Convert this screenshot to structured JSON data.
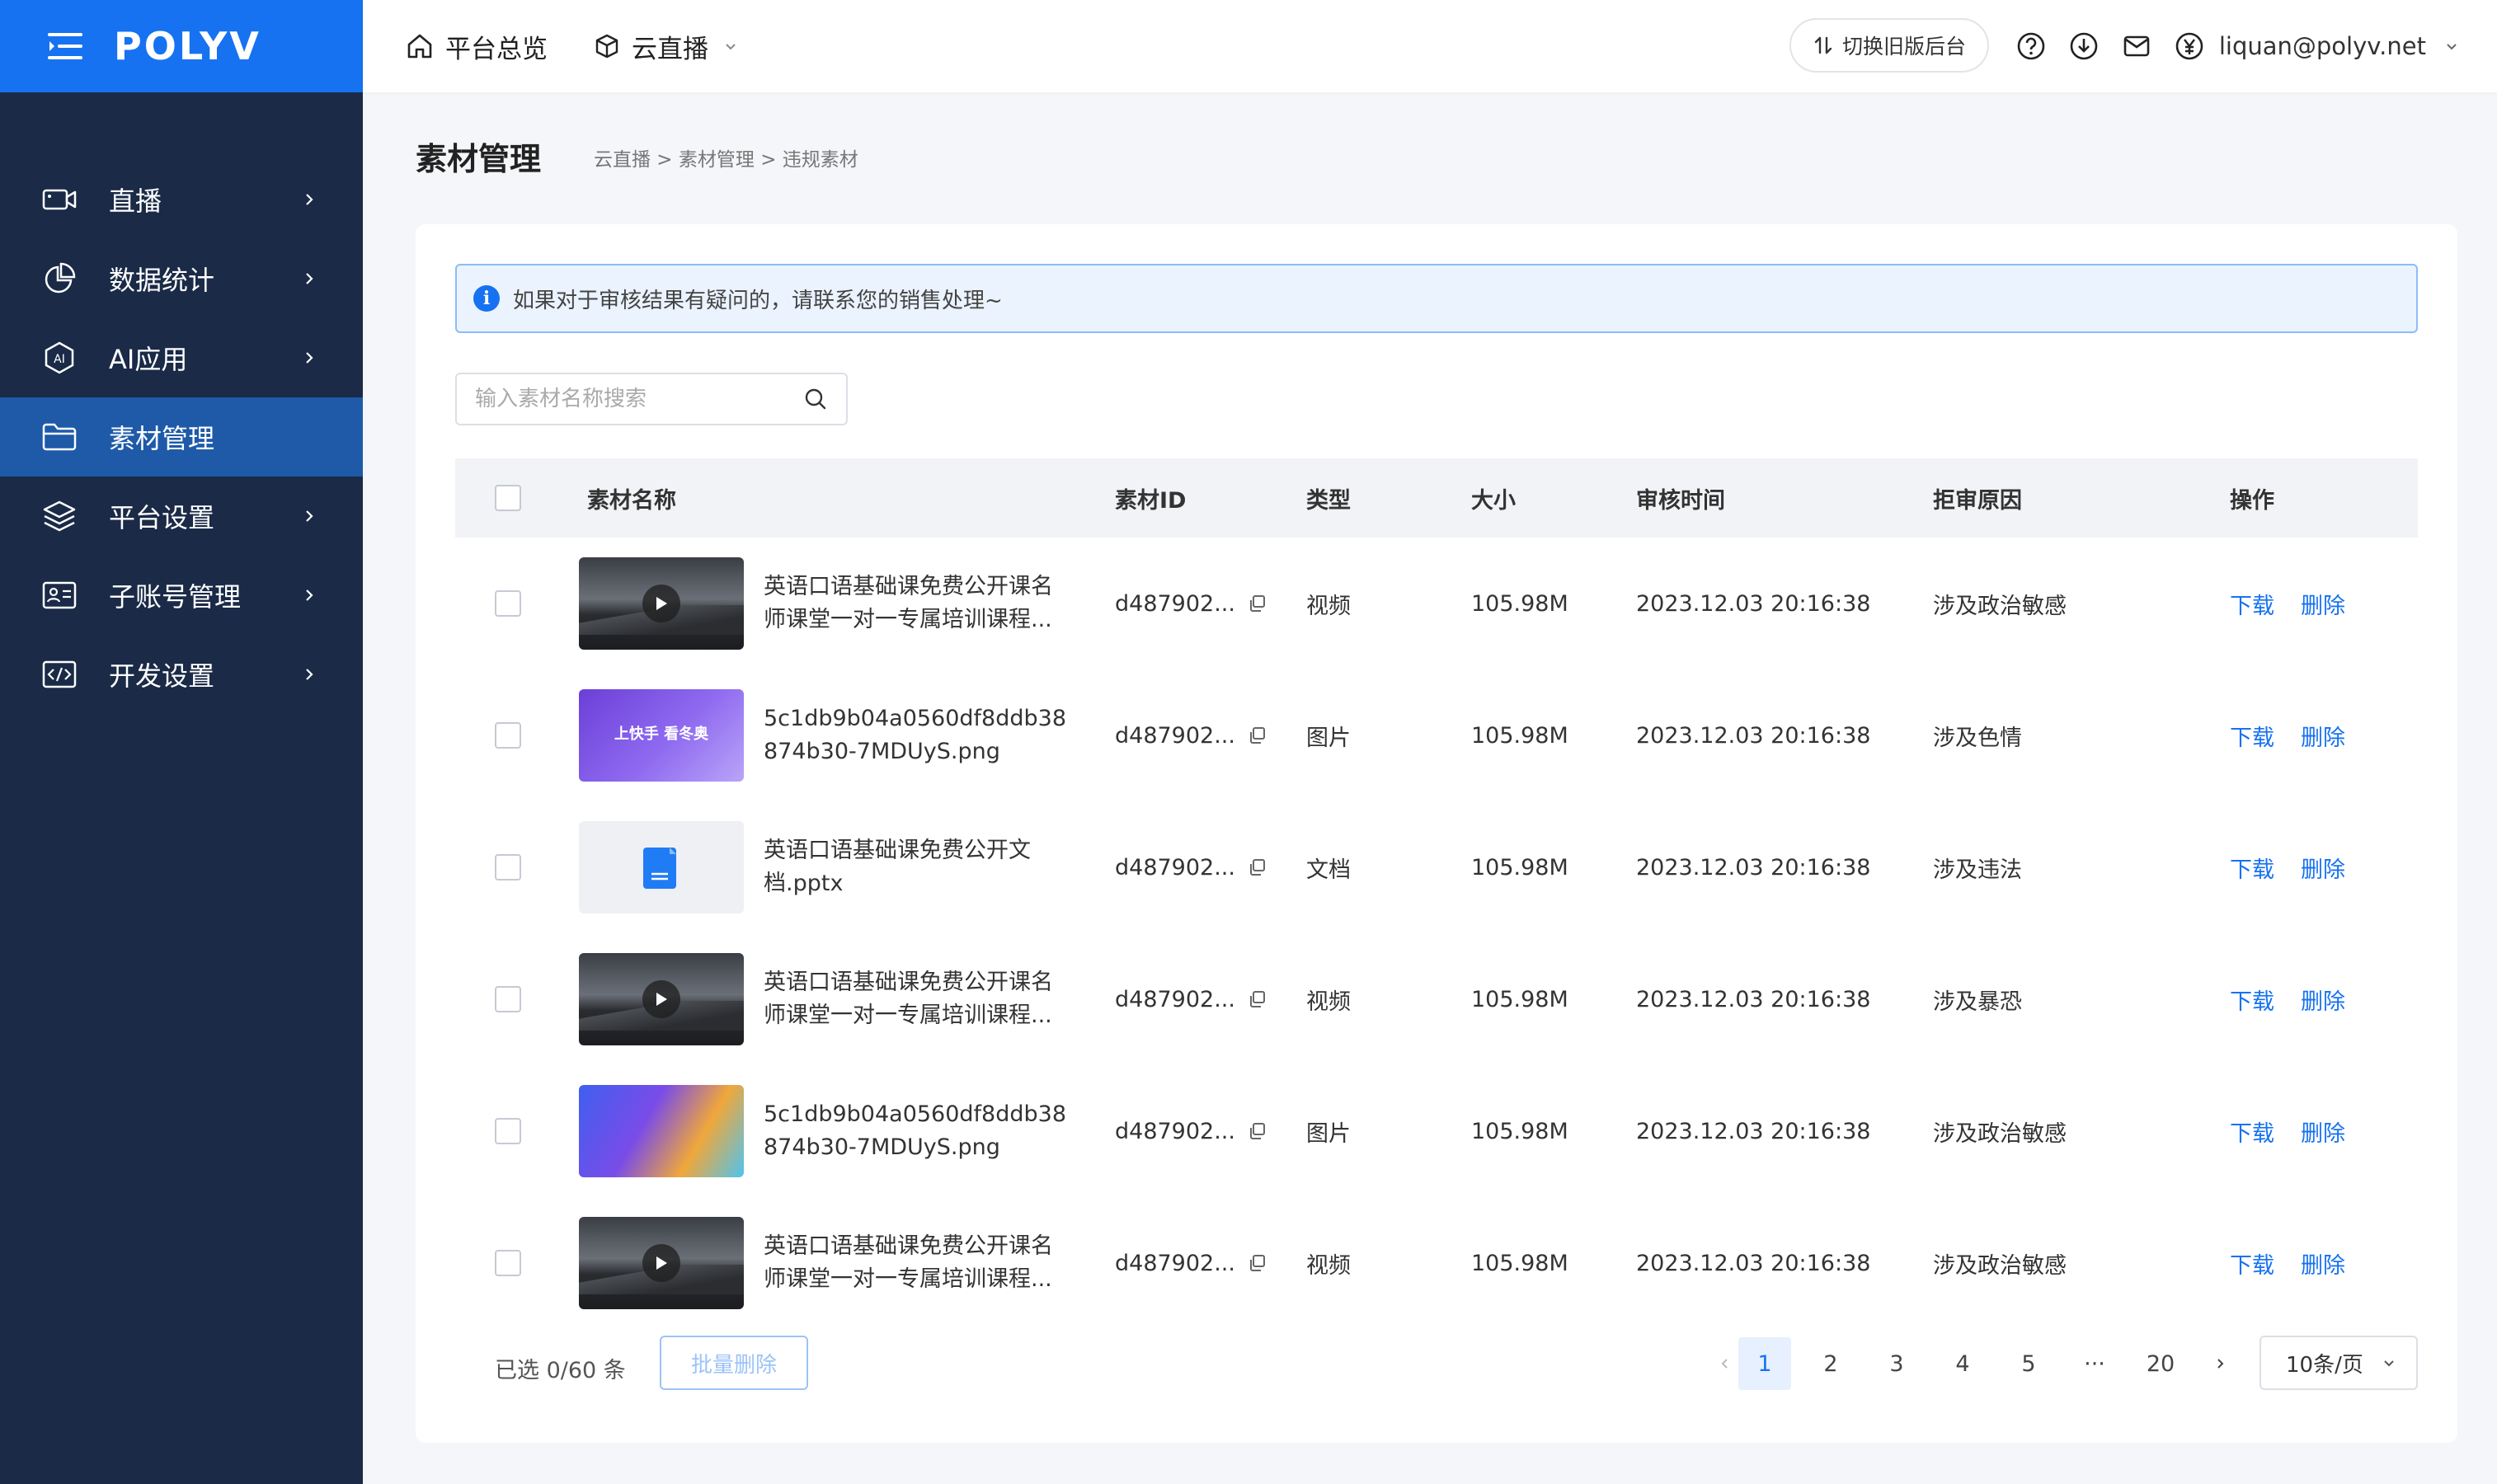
{
  "brand": {
    "logo": "POLYV",
    "primary": "#1672f1",
    "sidebar_bg": "#1a2a47",
    "active_bg": "#1e5aa8"
  },
  "sidebar": {
    "items": [
      {
        "label": "直播",
        "icon": "video-camera-icon",
        "active": false
      },
      {
        "label": "数据统计",
        "icon": "pie-chart-icon",
        "active": false
      },
      {
        "label": "AI应用",
        "icon": "ai-badge-icon",
        "active": false
      },
      {
        "label": "素材管理",
        "icon": "folder-icon",
        "active": true
      },
      {
        "label": "平台设置",
        "icon": "layers-icon",
        "active": false
      },
      {
        "label": "子账号管理",
        "icon": "id-card-icon",
        "active": false
      },
      {
        "label": "开发设置",
        "icon": "code-icon",
        "active": false
      }
    ]
  },
  "topbar": {
    "tabs": [
      {
        "label": "平台总览",
        "icon": "home-icon"
      },
      {
        "label": "云直播",
        "icon": "cube-icon"
      }
    ],
    "switch_label": "切换旧版后台",
    "icons": [
      "help-icon",
      "download-icon",
      "mail-icon",
      "yen-icon"
    ],
    "user": "liquan@polyv.net"
  },
  "page": {
    "title": "素材管理",
    "breadcrumb": "云直播 > 素材管理 > 违规素材"
  },
  "notice": "如果对于审核结果有疑问的，请联系您的销售处理~",
  "search": {
    "placeholder": "输入素材名称搜索",
    "value": ""
  },
  "table": {
    "headers": {
      "name": "素材名称",
      "id": "素材ID",
      "type": "类型",
      "size": "大小",
      "time": "审核时间",
      "reason": "拒审原因",
      "ops": "操作"
    },
    "rows": [
      {
        "thumb": "video",
        "name1": "英语口语基础课免费公开课名",
        "name2": "师课堂一对一专属培训课程...",
        "id": "d487902...",
        "type": "视频",
        "size": "105.98M",
        "time": "2023.12.03 20:16:38",
        "reason": "涉及政治敏感",
        "download": "下载",
        "delete": "删除"
      },
      {
        "thumb": "image1",
        "thumb_caption": "上快手 看冬奥",
        "name1": "5c1db9b04a0560df8ddb38",
        "name2": "874b30-7MDUyS.png",
        "id": "d487902...",
        "type": "图片",
        "size": "105.98M",
        "time": "2023.12.03 20:16:38",
        "reason": "涉及色情",
        "download": "下载",
        "delete": "删除"
      },
      {
        "thumb": "doc",
        "name1": "英语口语基础课免费公开文",
        "name2": "档.pptx",
        "id": "d487902...",
        "type": "文档",
        "size": "105.98M",
        "time": "2023.12.03 20:16:38",
        "reason": "涉及违法",
        "download": "下载",
        "delete": "删除"
      },
      {
        "thumb": "video",
        "name1": "英语口语基础课免费公开课名",
        "name2": "师课堂一对一专属培训课程...",
        "id": "d487902...",
        "type": "视频",
        "size": "105.98M",
        "time": "2023.12.03 20:16:38",
        "reason": "涉及暴恐",
        "download": "下载",
        "delete": "删除"
      },
      {
        "thumb": "image2",
        "thumb_caption": "",
        "name1": "5c1db9b04a0560df8ddb38",
        "name2": "874b30-7MDUyS.png",
        "id": "d487902...",
        "type": "图片",
        "size": "105.98M",
        "time": "2023.12.03 20:16:38",
        "reason": "涉及政治敏感",
        "download": "下载",
        "delete": "删除"
      },
      {
        "thumb": "video",
        "name1": "英语口语基础课免费公开课名",
        "name2": "师课堂一对一专属培训课程...",
        "id": "d487902...",
        "type": "视频",
        "size": "105.98M",
        "time": "2023.12.03 20:16:38",
        "reason": "涉及政治敏感",
        "download": "下载",
        "delete": "删除"
      }
    ]
  },
  "footer": {
    "selected": "已选 0/60 条",
    "batch_delete": "批量删除",
    "pages": [
      "1",
      "2",
      "3",
      "4",
      "5",
      "···",
      "20"
    ],
    "current_page": "1",
    "page_size": "10条/页"
  }
}
